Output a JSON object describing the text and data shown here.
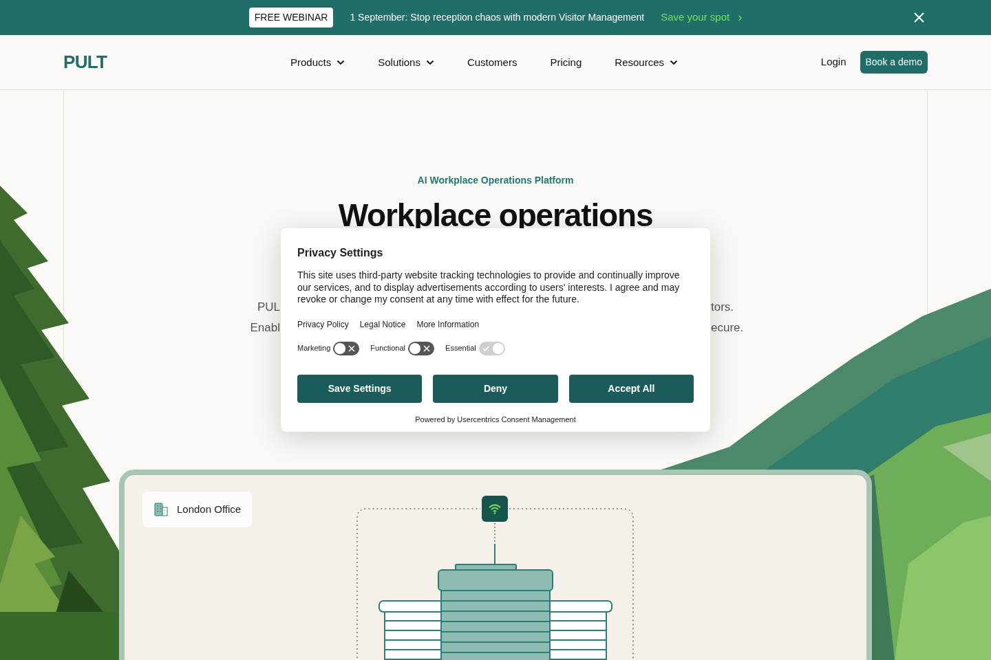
{
  "banner": {
    "badge": "FREE WEBINAR",
    "message": "1 September: Stop reception chaos with modern Visitor Management",
    "link": "Save your spot",
    "link_arrow": "›"
  },
  "nav": {
    "logo": "PULT",
    "items": [
      {
        "label": "Products",
        "dropdown": true
      },
      {
        "label": "Solutions",
        "dropdown": true
      },
      {
        "label": "Customers",
        "dropdown": false
      },
      {
        "label": "Pricing",
        "dropdown": false
      },
      {
        "label": "Resources",
        "dropdown": true
      }
    ],
    "login": "Login",
    "cta": "Book a demo"
  },
  "hero": {
    "eyebrow": "AI Workplace Operations Platform",
    "title": "Workplace operations",
    "left_fragments": [
      "PUL",
      "Enabl"
    ],
    "right_fragments": [
      "tors.",
      "ecure."
    ]
  },
  "card": {
    "location": "London Office"
  },
  "privacy_dialog": {
    "title": "Privacy Settings",
    "text": "This site uses third-party website tracking technologies to provide and continually improve our services, and to display advertisements according to users' interests. I agree and may revoke or change my consent at any time with effect for the future.",
    "links": [
      "Privacy Policy",
      "Legal Notice",
      "More Information"
    ],
    "toggles": [
      {
        "label": "Marketing",
        "on": false,
        "disabled": false
      },
      {
        "label": "Functional",
        "on": false,
        "disabled": false
      },
      {
        "label": "Essential",
        "on": true,
        "disabled": true
      }
    ],
    "buttons": [
      "Save Settings",
      "Deny",
      "Accept All"
    ],
    "footer": "Powered by Usercentrics Consent Management"
  }
}
